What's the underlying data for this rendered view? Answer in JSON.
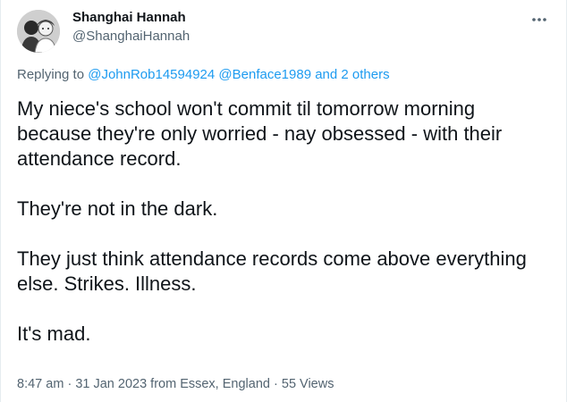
{
  "author": {
    "display_name": "Shanghai Hannah",
    "handle": "@ShanghaiHannah",
    "avatar_icon": "profile-photo"
  },
  "more_icon": "more-dots-icon",
  "reply_context": {
    "prefix": "Replying to",
    "mentions": [
      "@JohnRob14594924",
      "@Benface1989",
      "and 2 others"
    ]
  },
  "tweet": {
    "paragraphs": [
      "My niece's school won't commit til tomorrow morning because they're only worried - nay obsessed - with their attendance record.",
      "They're not in the dark.",
      "They just think attendance records come above everything else. Strikes. Illness.",
      "It's mad."
    ]
  },
  "meta": {
    "time": "8:47 am",
    "date": "31 Jan 2023",
    "location": "from Essex, England",
    "views": "55 Views"
  },
  "colors": {
    "link": "#1d9bf0",
    "secondary_text": "#536471",
    "primary_text": "#0f1419"
  }
}
